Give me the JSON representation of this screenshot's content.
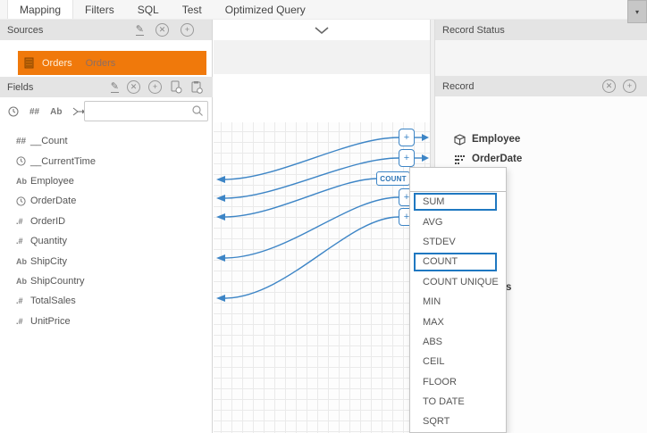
{
  "tabs": {
    "items": [
      {
        "label": "Mapping",
        "active": true
      },
      {
        "label": "Filters",
        "active": false
      },
      {
        "label": "SQL",
        "active": false
      },
      {
        "label": "Test",
        "active": false
      },
      {
        "label": "Optimized Query",
        "active": false
      }
    ]
  },
  "window": {
    "panel_toggle_glyph": "▾"
  },
  "sources_panel": {
    "title": "Sources",
    "source_name": "Orders",
    "source_alias": "Orders"
  },
  "fields_panel": {
    "title": "Fields",
    "search_value": "",
    "type_icons": {
      "integer": "##",
      "decimal": ".#",
      "text": "Ab"
    },
    "fields": [
      {
        "type": "integer",
        "name": "__Count"
      },
      {
        "type": "datetime",
        "name": "__CurrentTime"
      },
      {
        "type": "text",
        "name": "Employee"
      },
      {
        "type": "datetime",
        "name": "OrderDate"
      },
      {
        "type": "decimal",
        "name": "OrderID"
      },
      {
        "type": "decimal",
        "name": "Quantity"
      },
      {
        "type": "text",
        "name": "ShipCity"
      },
      {
        "type": "text",
        "name": "ShipCountry"
      },
      {
        "type": "decimal",
        "name": "TotalSales"
      },
      {
        "type": "decimal",
        "name": "UnitPrice"
      }
    ]
  },
  "canvas": {
    "aggregation_chip": "COUNT",
    "endpoint_glyph": "+",
    "connection_count": 5
  },
  "record_panel": {
    "status_title": "Record Status",
    "record_title": "Record",
    "fields": [
      {
        "name": "Employee"
      },
      {
        "name": "OrderDate"
      }
    ],
    "hidden_field_tail": "s"
  },
  "function_menu": {
    "items": [
      {
        "label": "SUM",
        "boxed": true
      },
      {
        "label": "AVG",
        "boxed": false
      },
      {
        "label": "STDEV",
        "boxed": false
      },
      {
        "label": "COUNT",
        "boxed": true
      },
      {
        "label": "COUNT UNIQUE",
        "boxed": false
      },
      {
        "label": "MIN",
        "boxed": false
      },
      {
        "label": "MAX",
        "boxed": false
      },
      {
        "label": "ABS",
        "boxed": false
      },
      {
        "label": "CEIL",
        "boxed": false
      },
      {
        "label": "FLOOR",
        "boxed": false
      },
      {
        "label": "TO DATE",
        "boxed": false
      },
      {
        "label": "SQRT",
        "boxed": false
      }
    ]
  },
  "colors": {
    "accent_orange": "#F0790B",
    "accent_blue": "#3D85C6",
    "menu_highlight": "#1F78C1"
  }
}
